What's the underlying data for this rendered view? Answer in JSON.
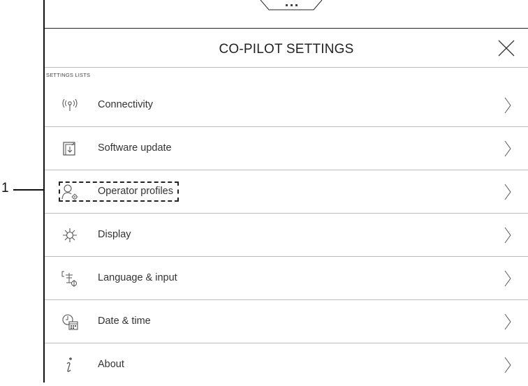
{
  "callout": {
    "number": "1"
  },
  "header": {
    "title": "CO-PILOT SETTINGS"
  },
  "section": {
    "label": "SETTINGS LISTS"
  },
  "settings": {
    "items": [
      {
        "label": "Connectivity",
        "icon": "antenna-icon"
      },
      {
        "label": "Software update",
        "icon": "software-update-icon"
      },
      {
        "label": "Operator profiles",
        "icon": "operator-profile-icon",
        "highlighted": true
      },
      {
        "label": "Display",
        "icon": "brightness-icon"
      },
      {
        "label": "Language & input",
        "icon": "language-icon"
      },
      {
        "label": "Date & time",
        "icon": "clock-calendar-icon"
      },
      {
        "label": "About",
        "icon": "info-icon"
      }
    ]
  }
}
